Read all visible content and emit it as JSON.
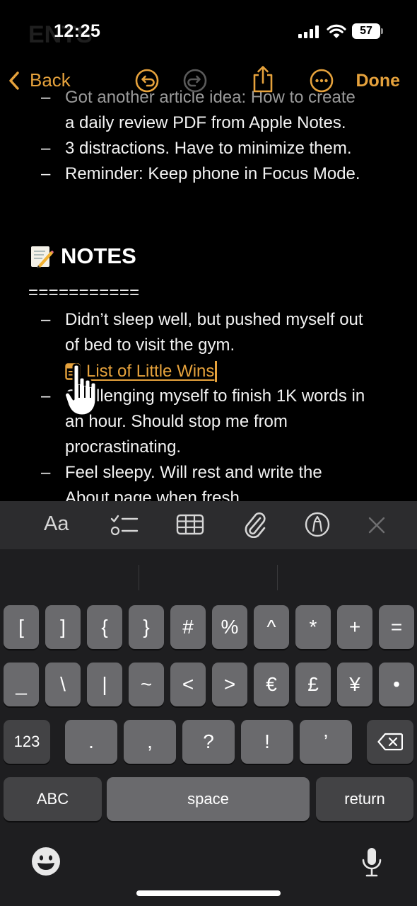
{
  "status_bar": {
    "time": "12:25",
    "battery": "57"
  },
  "faded_heading": "ENTS",
  "nav": {
    "back_label": "Back",
    "done_label": "Done",
    "icons": [
      "undo-icon",
      "redo-icon",
      "share-icon",
      "more-icon"
    ]
  },
  "note": {
    "top_items": [
      {
        "text": "Got another article idea: How to create",
        "faded": true
      },
      {
        "text": "a daily review PDF from Apple Notes.",
        "faded": false
      },
      {
        "text": "3 distractions. Have to minimize them.",
        "faded": false
      },
      {
        "text": "Reminder: Keep phone in Focus Mode.",
        "faded": false
      }
    ],
    "notes_heading": "NOTES",
    "divider": "===========",
    "item1_lines": [
      "Didn’t sleep well, but pushed myself out",
      "of bed to visit the gym."
    ],
    "link_label": "List of Little Wins",
    "item2_lines": [
      "Challenging myself to finish 1K words in",
      "an hour. Should stop me from",
      "procrastinating."
    ],
    "item3_lines": [
      "Feel sleepy. Will rest and write the",
      "About page when fresh."
    ]
  },
  "format_bar": {
    "text_style_label": "Aa",
    "icons": [
      "checklist-icon",
      "table-icon",
      "attachment-icon",
      "markup-icon",
      "close-icon"
    ]
  },
  "keyboard": {
    "row1": [
      "[",
      "]",
      "{",
      "}",
      "#",
      "%",
      "^",
      "*",
      "+",
      "="
    ],
    "row2": [
      "_",
      "\\",
      "|",
      "~",
      "<",
      ">",
      "€",
      "£",
      "¥",
      "•"
    ],
    "row3_left": "123",
    "row3": [
      ".",
      ",",
      "?",
      "!",
      "’"
    ],
    "abc_label": "ABC",
    "space_label": "space",
    "return_label": "return"
  }
}
